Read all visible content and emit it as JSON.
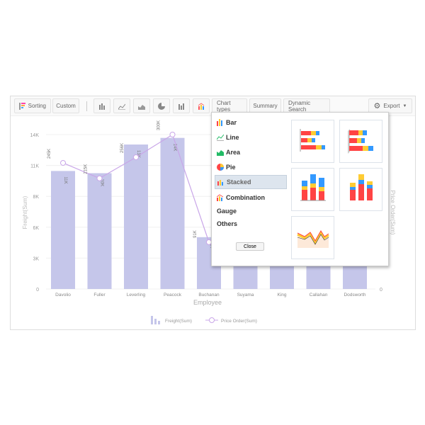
{
  "toolbar": {
    "sorting": "Sorting",
    "custom": "Custom",
    "chart_types": "Chart types",
    "summary": "Summary",
    "dynamic_search": "Dynamic Search",
    "export": "Export",
    "icons": [
      "bar-chart-icon",
      "line-chart-icon",
      "area-chart-icon",
      "pie-chart-icon",
      "stacked-chart-icon",
      "combination-chart-icon"
    ]
  },
  "popup": {
    "items": [
      {
        "label": "Bar",
        "icon": "bar-icon"
      },
      {
        "label": "Line",
        "icon": "line-icon"
      },
      {
        "label": "Area",
        "icon": "area-icon"
      },
      {
        "label": "Pie",
        "icon": "pie-icon"
      },
      {
        "label": "Stacked",
        "icon": "stacked-icon",
        "selected": true
      },
      {
        "label": "Combination",
        "icon": "combination-icon"
      },
      {
        "label": "Gauge"
      },
      {
        "label": "Others"
      }
    ],
    "close": "Close",
    "thumbnails": [
      "stacked-bar-horizontal",
      "stacked-bar-horizontal-3d",
      "stacked-column",
      "stacked-column-3d",
      "stacked-area"
    ]
  },
  "chart_data": {
    "type": "bar+line",
    "categories": [
      "Davolio",
      "Fuller",
      "Leverling",
      "Peacock",
      "Buchanan",
      "Suyama",
      "King",
      "Callahan",
      "Dodsworth"
    ],
    "series": [
      {
        "name": "Freight(Sum)",
        "type": "bar",
        "axis": "left",
        "values": [
          10.7,
          10.5,
          13.1,
          13.7,
          4.7,
          null,
          null,
          null,
          null
        ],
        "labels": [
          "11K",
          "10K",
          "13K",
          "14K",
          "5K"
        ]
      },
      {
        "name": "Price Order(Sum)",
        "type": "line",
        "axis": "right",
        "values": [
          245,
          215,
          256,
          300,
          91,
          null,
          null,
          null,
          null
        ],
        "labels": [
          "245K",
          "215K",
          "256K",
          "300K",
          "91K"
        ]
      }
    ],
    "xlabel": "Employee",
    "ylabel": "Freight(Sum)",
    "y2label": "Price Order(Sum)",
    "yticks": [
      "0",
      "3K",
      "6K",
      "8K",
      "11K",
      "14K"
    ],
    "y2ticks": [
      "0"
    ],
    "ylim": [
      0,
      14
    ],
    "y2lim": [
      0,
      300
    ],
    "legend": "bottom",
    "grid": true,
    "colors": {
      "bar": "#c5c6ea",
      "line": "#c9a6e8"
    }
  }
}
